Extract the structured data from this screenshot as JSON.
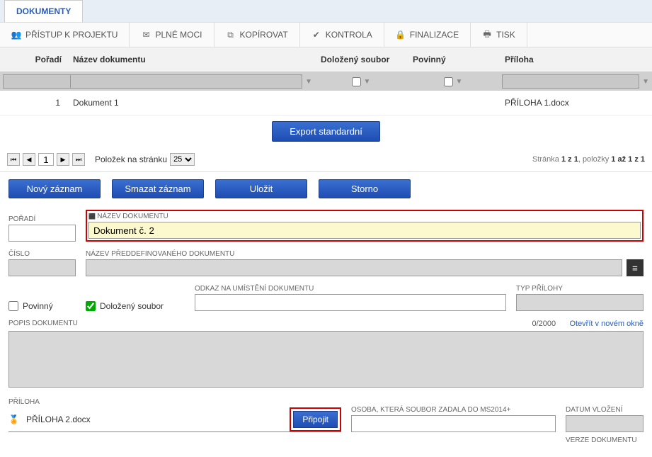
{
  "tab": {
    "title": "DOKUMENTY"
  },
  "toolbar": {
    "pristup": "PŘÍSTUP K PROJEKTU",
    "plnemoci": "PLNÉ MOCI",
    "kopirovat": "KOPÍROVAT",
    "kontrola": "KONTROLA",
    "finalizace": "FINALIZACE",
    "tisk": "TISK"
  },
  "grid": {
    "headers": {
      "poradi": "Pořadí",
      "nazev": "Název dokumentu",
      "dolozeny": "Doložený soubor",
      "povinny": "Povinný",
      "priloha": "Příloha"
    },
    "rows": [
      {
        "poradi": "1",
        "nazev": "Dokument 1",
        "dolozeny": false,
        "povinny": false,
        "priloha": "PŘÍLOHA 1.docx"
      }
    ],
    "export_btn": "Export standardní"
  },
  "pagination": {
    "page": "1",
    "per_page_label": "Položek na stránku",
    "per_page": "25",
    "summary_prefix": "Stránka ",
    "summary_pages": "1 z 1",
    "summary_mid": ", položky ",
    "summary_items": "1 až 1 z 1"
  },
  "form_buttons": {
    "novy": "Nový záznam",
    "smazat": "Smazat záznam",
    "ulozit": "Uložit",
    "storno": "Storno"
  },
  "form": {
    "poradi_label": "POŘADÍ",
    "poradi_value": "",
    "nazev_label": "NÁZEV DOKUMENTU",
    "nazev_value": "Dokument č. 2",
    "cislo_label": "ČÍSLO",
    "cislo_value": "",
    "preddef_label": "NÁZEV PŘEDDEFINOVANÉHO DOKUMENTU",
    "preddef_value": "",
    "povinny_label": "Povinný",
    "dolozeny_label": "Doložený soubor",
    "odkaz_label": "ODKAZ NA UMÍSTĚNÍ DOKUMENTU",
    "odkaz_value": "",
    "typ_label": "TYP PŘÍLOHY",
    "typ_value": "",
    "popis_label": "POPIS DOKUMENTU",
    "popis_counter": "0/2000",
    "popis_link": "Otevřít v novém okně",
    "priloha_label": "PŘÍLOHA",
    "priloha_value": "PŘÍLOHA 2.docx",
    "pripojit_btn": "Připojit",
    "osoba_label": "OSOBA, KTERÁ SOUBOR ZADALA DO MS2014+",
    "osoba_value": "",
    "datum_label": "DATUM VLOŽENÍ",
    "datum_value": "",
    "verze_label": "VERZE DOKUMENTU"
  }
}
